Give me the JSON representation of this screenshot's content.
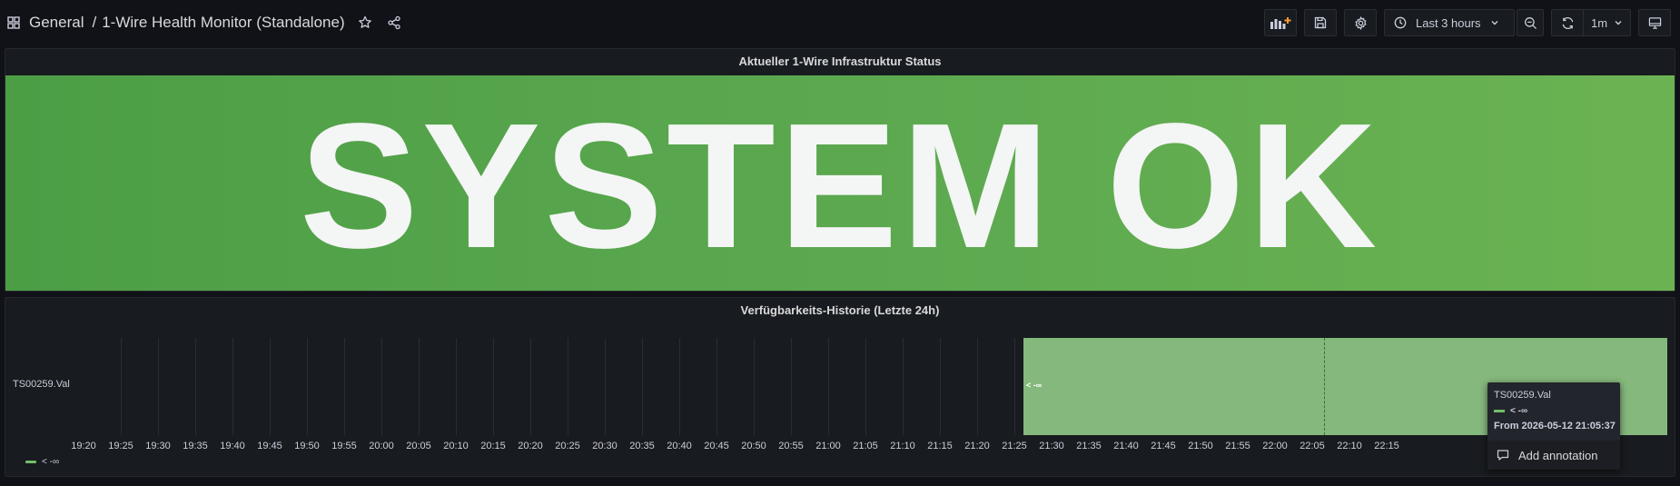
{
  "header": {
    "folder": "General",
    "separator": "/",
    "title": "1-Wire Health Monitor (Standalone)"
  },
  "toolbar": {
    "time_range": "Last 3 hours",
    "refresh_interval": "1m"
  },
  "status_panel": {
    "title": "Aktueller 1-Wire Infrastruktur Status",
    "value": "SYSTEM OK",
    "color": "#5aa64e"
  },
  "history_panel": {
    "title": "Verfügbarkeits-Historie (Letzte 24h)",
    "series_label": "TS00259.Val",
    "state_value": "< -∞",
    "legend_label": "< -∞",
    "state_color": "#85b87c",
    "ticks": [
      "19:20",
      "19:25",
      "19:30",
      "19:35",
      "19:40",
      "19:45",
      "19:50",
      "19:55",
      "20:00",
      "20:05",
      "20:10",
      "20:15",
      "20:20",
      "20:25",
      "20:30",
      "20:35",
      "20:40",
      "20:45",
      "20:50",
      "20:55",
      "21:00",
      "21:05",
      "21:10",
      "21:15",
      "21:20",
      "21:25",
      "21:30",
      "21:35",
      "21:40",
      "21:45",
      "21:50",
      "21:55",
      "22:00",
      "22:05",
      "22:10",
      "22:15"
    ]
  },
  "tooltip": {
    "series": "TS00259.Val",
    "value": "< -∞",
    "from": "From 2026-05-12 21:05:37",
    "action": "Add annotation"
  }
}
